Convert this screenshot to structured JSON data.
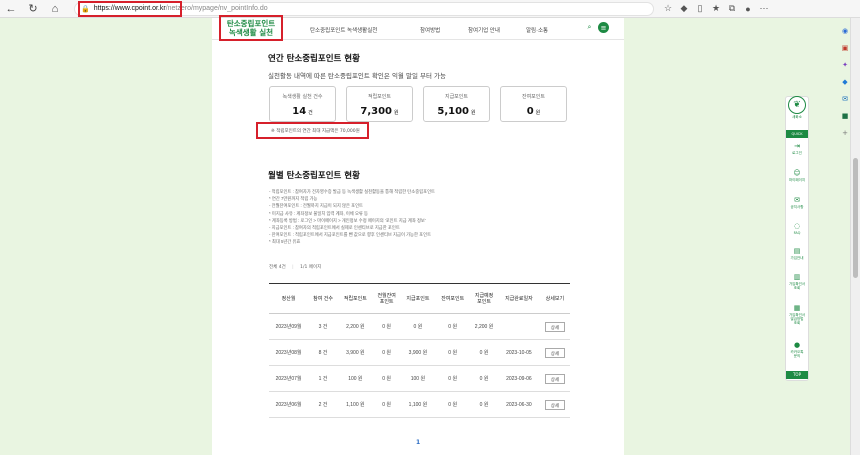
{
  "browser": {
    "url_host": "https://www.cpoint.or.kr",
    "url_path": "/netzero/mypage/nv_pointInfo.do"
  },
  "header": {
    "logo_line1": "탄소중립포인트",
    "logo_line2": "녹색생활 실천",
    "nav": [
      "탄소중립포인트 녹색생활실천",
      "참여방법",
      "참여기업 안내",
      "알림·소통"
    ]
  },
  "annual": {
    "title": "연간 탄소중립포인트 현황",
    "subtitle": "실천활동 내역에 따른 탄소중립포인트 확인은 익월 말일 부터 가능",
    "cards": [
      {
        "label": "녹색생활 실천 건수",
        "value": "14",
        "unit": "건"
      },
      {
        "label": "적립포인트",
        "value": "7,300",
        "unit": "원"
      },
      {
        "label": "지급포인트",
        "value": "5,100",
        "unit": "원"
      },
      {
        "label": "잔여포인트",
        "value": "0",
        "unit": "원"
      }
    ],
    "note": "※ 적립포인트의 연간 최대 지급액은 70,000원"
  },
  "monthly": {
    "title": "월별 탄소중립포인트 현황",
    "bullets": [
      "- 적립포인트 : 참여자가 전자영수증 발급 등 녹색생활 실천활동을 통해 적립한 탄소중립포인트",
      "* 연간 7만원까지 적립 가능",
      "- 전월잔여포인트 : 전월까지 지급이 되지 않은 포인트",
      "* 미지급 사유 : 계좌정보 불일치 입력 계좌, 이체 오류 등",
      "* 계좌등록 방법 : 로그인 > 마이페이지 > 개인정보 수정 페이지의 '포인트 지급 계좌 정보'",
      "- 지급포인트 : 참여자의 적립포인트에서 실제로 인센티브로 지급한 포인트",
      "- 잔여포인트 : 적립포인트에서 지급포인트를 뺀 값으로 향후 인센티브 지급이 가능한 포인트",
      "* 최대 5년간 유효"
    ],
    "total_label": "전체 4건",
    "page_label": "1/1 페이지",
    "columns": [
      "정산월",
      "참여 건수",
      "적립포인트",
      "전월잔여\n포인트",
      "지급포인트",
      "잔여포인트",
      "지급예정\n포인트",
      "지급완료일자",
      "상세보기"
    ],
    "rows": [
      [
        "2023년09월",
        "3 건",
        "2,200 원",
        "0 원",
        "0 원",
        "0 원",
        "2,200 원",
        "",
        "상세"
      ],
      [
        "2023년08월",
        "8 건",
        "3,900 원",
        "0 원",
        "3,900 원",
        "0 원",
        "0 원",
        "2023-10-05",
        "상세"
      ],
      [
        "2023년07월",
        "1 건",
        "100 원",
        "0 원",
        "100 원",
        "0 원",
        "0 원",
        "2023-09-06",
        "상세"
      ],
      [
        "2023년06월",
        "2 건",
        "1,100 원",
        "0 원",
        "1,100 원",
        "0 원",
        "0 원",
        "2023-06-30",
        "상세"
      ]
    ],
    "pagination": "1"
  },
  "quick_menu": {
    "top_label": "새화소",
    "header": "QUICK",
    "items": [
      "로그인",
      "마이페이지",
      "공지사항",
      "FAQ",
      "가입안내",
      "가입확인서\n조회",
      "가입확인서\n발급방법\n조회",
      "카카오톡\n문의"
    ],
    "top_button": "TOP"
  },
  "colors": {
    "accent": "#1d8a43",
    "highlight": "#d6202b",
    "side_bg": "#e9f5e1"
  }
}
